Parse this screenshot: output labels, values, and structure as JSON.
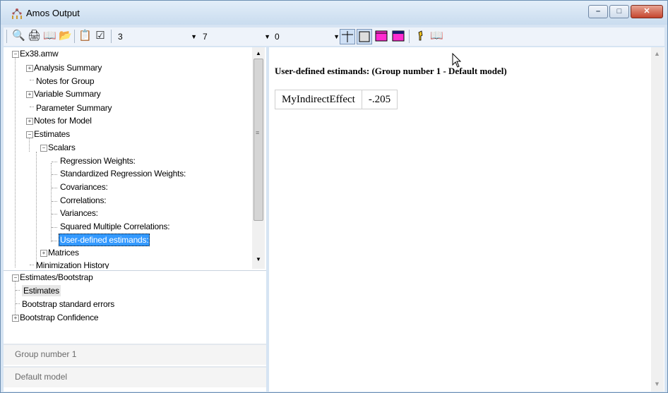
{
  "window": {
    "title": "Amos Output",
    "caption_buttons": {
      "minimize": "–",
      "maximize": "□",
      "close": "✕"
    }
  },
  "toolbar": {
    "icons": [
      "print-preview-icon",
      "print-icon",
      "book-icon",
      "open-folder-icon",
      "copy-icon",
      "checkbox-icon"
    ],
    "combo1_value": "3",
    "combo2_value": "7",
    "combo3_value": "0",
    "view_icons": [
      "crosshair-icon",
      "table-icon",
      "magenta-header-icon",
      "magenta-grid-icon",
      "hint-icon",
      "help-book-icon"
    ]
  },
  "tree": {
    "root": "Ex38.amw",
    "items": [
      {
        "label": "Analysis Summary"
      },
      {
        "label": "Notes for Group"
      },
      {
        "label": "Variable Summary"
      },
      {
        "label": "Parameter Summary"
      },
      {
        "label": "Notes for Model"
      },
      {
        "label": "Estimates"
      },
      {
        "label": "Scalars"
      },
      {
        "label": "Regression Weights:"
      },
      {
        "label": "Standardized Regression Weights:"
      },
      {
        "label": "Covariances:"
      },
      {
        "label": "Correlations:"
      },
      {
        "label": "Variances:"
      },
      {
        "label": "Squared Multiple Correlations:"
      },
      {
        "label": "User-defined estimands:"
      },
      {
        "label": "Matrices"
      },
      {
        "label": "Minimization History"
      }
    ]
  },
  "bootstrap_tree": {
    "root": "Estimates/Bootstrap",
    "items": [
      {
        "label": "Estimates"
      },
      {
        "label": "Bootstrap standard errors"
      },
      {
        "label": "Bootstrap Confidence"
      }
    ]
  },
  "group_panel": {
    "label": "Group number 1"
  },
  "model_panel": {
    "label": "Default model"
  },
  "output": {
    "heading": "User-defined estimands: (Group number 1 - Default model)",
    "rows": [
      {
        "name": "MyIndirectEffect",
        "value": "-.205"
      }
    ]
  }
}
